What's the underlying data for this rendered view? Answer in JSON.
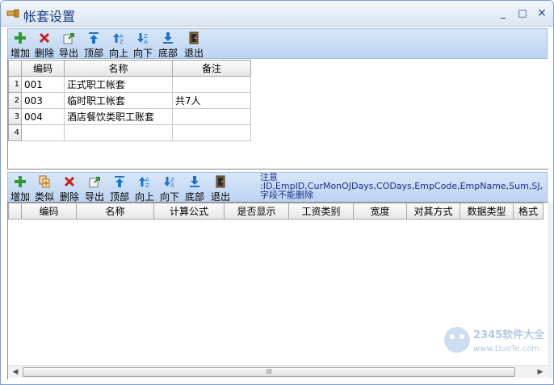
{
  "window": {
    "title": "帐套设置",
    "controls": [
      "_",
      "□",
      "×"
    ]
  },
  "toolbar_top": [
    {
      "label": "增加",
      "icon": "add-icon",
      "color": "#2c9d2c"
    },
    {
      "label": "删除",
      "icon": "delete-icon",
      "color": "#c62020"
    },
    {
      "label": "导出",
      "icon": "export-icon",
      "color": "#6a8e3a"
    },
    {
      "label": "顶部",
      "icon": "move-top-icon",
      "color": "#1e74c8"
    },
    {
      "label": "向上",
      "icon": "move-up-icon",
      "color": "#1e74c8"
    },
    {
      "label": "向下",
      "icon": "move-down-icon",
      "color": "#1e74c8"
    },
    {
      "label": "底部",
      "icon": "move-bottom-icon",
      "color": "#1e74c8"
    },
    {
      "label": "退出",
      "icon": "exit-icon",
      "color": "#7a5a2a"
    }
  ],
  "grid_top": {
    "columns": [
      "编码",
      "名称",
      "备注"
    ],
    "rows": [
      {
        "num": "1",
        "code": "001",
        "name": "正式职工帐套",
        "note": ""
      },
      {
        "num": "2",
        "code": "003",
        "name": "临时职工帐套",
        "note": "共7人"
      },
      {
        "num": "3",
        "code": "004",
        "name": "酒店餐饮类职工账套",
        "note": ""
      },
      {
        "num": "4",
        "code": "",
        "name": "",
        "note": ""
      }
    ]
  },
  "toolbar_bottom": [
    {
      "label": "增加",
      "icon": "add-icon",
      "color": "#2c9d2c"
    },
    {
      "label": "类似",
      "icon": "similar-icon",
      "color": "#d08a20"
    },
    {
      "label": "删除",
      "icon": "delete-icon",
      "color": "#c62020"
    },
    {
      "label": "导出",
      "icon": "export-icon",
      "color": "#6a8e3a"
    },
    {
      "label": "顶部",
      "icon": "move-top-icon",
      "color": "#1e74c8"
    },
    {
      "label": "向上",
      "icon": "move-up-icon",
      "color": "#1e74c8"
    },
    {
      "label": "向下",
      "icon": "move-down-icon",
      "color": "#1e74c8"
    },
    {
      "label": "底部",
      "icon": "move-bottom-icon",
      "color": "#1e74c8"
    },
    {
      "label": "退出",
      "icon": "exit-icon",
      "color": "#7a5a2a"
    }
  ],
  "note": {
    "heading": "注意",
    "line1": ":ID,EmpID,CurMonOJDays,CODays,EmpCode,EmpName,Sum,SJ,YFGZ等",
    "line2": "字段不能删除"
  },
  "grid_bottom": {
    "columns": [
      "编码",
      "名称",
      "计算公式",
      "是否显示",
      "工资类别",
      "宽度",
      "对其方式",
      "数据类型",
      "格式"
    ]
  },
  "scrollbar": {
    "thumb_grip": "III",
    "left_arrow": "◀",
    "right_arrow": "▶"
  },
  "watermark": {
    "text": "2345软件大全",
    "url": "www.DuoTe.com"
  },
  "colors": {
    "title_text": "#1d3e80",
    "toolbar_bg": "#c9dcf4",
    "note_text": "#1b2f87"
  }
}
